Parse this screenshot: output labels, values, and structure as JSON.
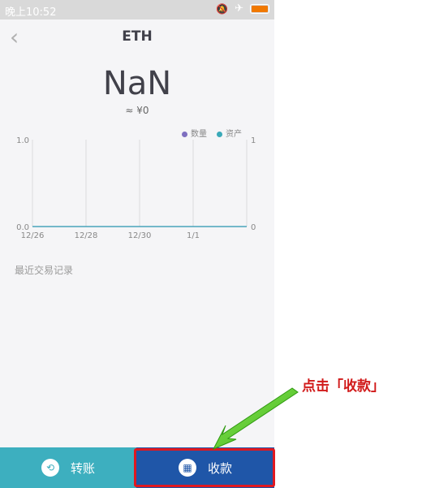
{
  "status_bar": {
    "time": "晚上10:52"
  },
  "header": {
    "back_icon": "chevron-left-icon",
    "title": "ETH"
  },
  "balance": {
    "amount": "NaN",
    "fiat_value": "≈ ¥0"
  },
  "chart_data": {
    "type": "line",
    "x": [
      "12/26",
      "12/28",
      "12/30",
      "1/1"
    ],
    "series": [
      {
        "name": "数量",
        "color": "#7e6fc0",
        "values": [
          0.0,
          0.0,
          0.0,
          0.0
        ]
      },
      {
        "name": "资产",
        "color": "#3aa9b8",
        "values": [
          0,
          0,
          0,
          0
        ]
      }
    ],
    "left_ticks": [
      "1.0",
      "0.0"
    ],
    "right_ticks": [
      "1",
      "0"
    ],
    "ylim_left": [
      0,
      1
    ],
    "ylim_right": [
      0,
      1
    ],
    "grid": true,
    "legend": "top-right"
  },
  "records": {
    "title": "最近交易记录"
  },
  "actions": {
    "transfer_label": "转账",
    "receive_label": "收款"
  },
  "annotation": {
    "text": "点击「收款」"
  },
  "colors": {
    "transfer": "#3dafbf",
    "receive": "#1f56a8",
    "highlight": "#e01820",
    "arrow": "#5fd320"
  }
}
